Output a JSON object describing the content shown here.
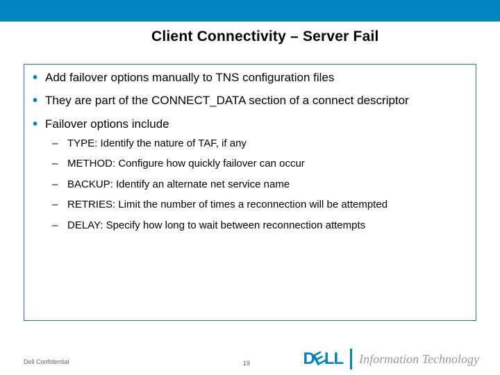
{
  "title": "Client Connectivity – Server Fail",
  "bullets": [
    {
      "text": "Add failover options manually to TNS configuration files"
    },
    {
      "text": "They are part of the CONNECT_DATA section of a connect descriptor"
    },
    {
      "text": "Failover options include"
    }
  ],
  "sub_bullets": [
    "TYPE: Identify the nature of TAF, if any",
    "METHOD: Configure how quickly failover can occur",
    "BACKUP: Identify an alternate net service name",
    "RETRIES: Limit the number of times a reconnection will be attempted",
    "DELAY: Specify how long to wait between reconnection attempts"
  ],
  "footer": {
    "confidential": "Dell Confidential",
    "page": "19",
    "logo_brand": "Dell",
    "logo_suffix": "Information Technology"
  }
}
